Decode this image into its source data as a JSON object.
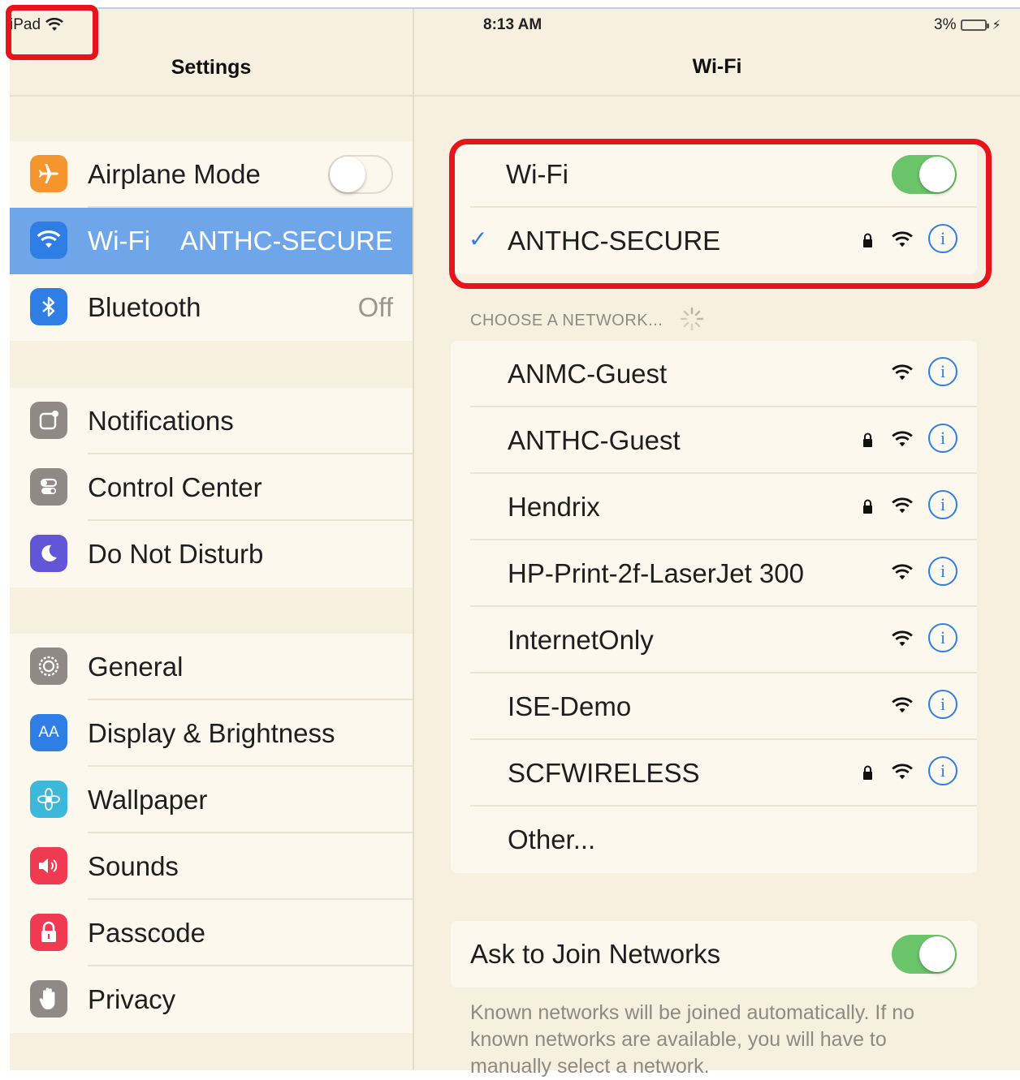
{
  "status_bar": {
    "device": "iPad",
    "time": "8:13 AM",
    "battery_percent": "3%"
  },
  "left_pane": {
    "title": "Settings",
    "group1": [
      {
        "label": "Airplane Mode",
        "icon": "airplane-icon",
        "color": "#f4952e",
        "toggle": "off"
      },
      {
        "label": "Wi-Fi",
        "value": "ANTHC-SECURE",
        "icon": "wifi-icon",
        "color": "#2f7ee6",
        "selected": true
      },
      {
        "label": "Bluetooth",
        "value": "Off",
        "icon": "bluetooth-icon",
        "color": "#2f7ee6"
      }
    ],
    "group2": [
      {
        "label": "Notifications",
        "icon": "notifications-icon",
        "color": "#8f8a86"
      },
      {
        "label": "Control Center",
        "icon": "control-center-icon",
        "color": "#8f8a86"
      },
      {
        "label": "Do Not Disturb",
        "icon": "moon-icon",
        "color": "#6157d6"
      }
    ],
    "group3": [
      {
        "label": "General",
        "icon": "gear-icon",
        "color": "#8f8a86"
      },
      {
        "label": "Display & Brightness",
        "icon": "display-icon",
        "color": "#2f7ee6",
        "glyph": "AA"
      },
      {
        "label": "Wallpaper",
        "icon": "wallpaper-icon",
        "color": "#3cb8d8"
      },
      {
        "label": "Sounds",
        "icon": "speaker-icon",
        "color": "#f03a52"
      },
      {
        "label": "Passcode",
        "icon": "lock-icon",
        "color": "#f03a52"
      },
      {
        "label": "Privacy",
        "icon": "hand-icon",
        "color": "#8f8a86"
      }
    ]
  },
  "right_pane": {
    "title": "Wi-Fi",
    "wifi_toggle_label": "Wi-Fi",
    "wifi_enabled": true,
    "connected_network": "ANTHC-SECURE",
    "choose_network_header": "CHOOSE A NETWORK...",
    "networks": [
      {
        "name": "ANMC-Guest",
        "locked": false
      },
      {
        "name": "ANTHC-Guest",
        "locked": true
      },
      {
        "name": "Hendrix",
        "locked": true
      },
      {
        "name": "HP-Print-2f-LaserJet 300",
        "locked": false
      },
      {
        "name": "InternetOnly",
        "locked": false
      },
      {
        "name": "ISE-Demo",
        "locked": false
      },
      {
        "name": "SCFWIRELESS",
        "locked": true
      }
    ],
    "other_label": "Other...",
    "ask_to_join_label": "Ask to Join Networks",
    "ask_to_join_enabled": true,
    "footnote": "Known networks will be joined automatically. If no known networks are available, you will have to manually select a network."
  },
  "colors": {
    "highlight_red": "#e8141c",
    "accent_blue": "#2f7ee6",
    "toggle_green": "#6cc46a",
    "selected_row": "#6fa6ea"
  }
}
